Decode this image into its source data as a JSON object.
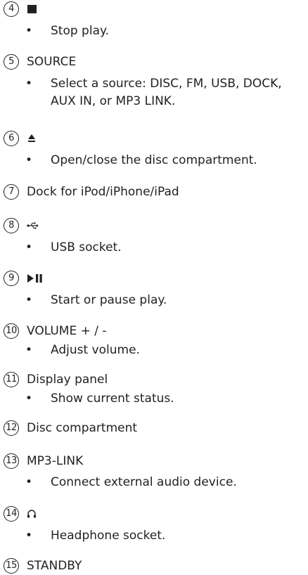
{
  "items": [
    {
      "num": "4",
      "title": "",
      "icon": "stop-icon",
      "bullet": "Stop play."
    },
    {
      "num": "5",
      "title": "SOURCE",
      "bullet": "Select a source: DISC, FM, USB, DOCK, AUX IN, or MP3 LINK."
    },
    {
      "num": "6",
      "title": "",
      "icon": "eject-icon",
      "bullet": "Open/close the disc compartment."
    },
    {
      "num": "7",
      "title": "Dock for iPod/iPhone/iPad"
    },
    {
      "num": "8",
      "title": "",
      "icon": "usb-icon",
      "bullet": "USB socket."
    },
    {
      "num": "9",
      "title": "",
      "icon": "play-pause-icon",
      "bullet": "Start or pause play."
    },
    {
      "num": "10",
      "title": "VOLUME + / -",
      "bullet": "Adjust volume."
    },
    {
      "num": "11",
      "title": "Display panel",
      "bullet": "Show current status."
    },
    {
      "num": "12",
      "title": "Disc compartment"
    },
    {
      "num": "13",
      "title": "MP3-LINK",
      "bullet": "Connect external audio device."
    },
    {
      "num": "14",
      "title": "",
      "icon": "headphone-icon",
      "bullet": "Headphone socket."
    },
    {
      "num": "15",
      "title": "STANDBY"
    }
  ]
}
